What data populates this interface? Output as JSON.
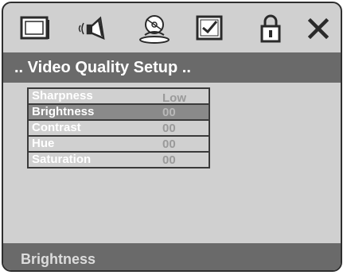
{
  "icon_bar": {
    "icons": [
      "monitor-icon",
      "speaker-icon",
      "disc-icon",
      "checklist-icon",
      "lock-icon",
      "close-icon"
    ]
  },
  "title": ".. Video Quality Setup ..",
  "menu": {
    "items": [
      {
        "label": "Sharpness",
        "value": "Low"
      },
      {
        "label": "Brightness",
        "value": "00"
      },
      {
        "label": "Contrast",
        "value": "00"
      },
      {
        "label": "Hue",
        "value": "00"
      },
      {
        "label": "Saturation",
        "value": "00"
      }
    ],
    "selected": "Brightness"
  },
  "status": {
    "text": "Brightness"
  },
  "colors": {
    "panel": "#d0d0d0",
    "title_bar": "#6a6a6a",
    "highlight": "#8a8a8a",
    "label_text": "#ffffff",
    "value_text": "#9a9a9a"
  }
}
